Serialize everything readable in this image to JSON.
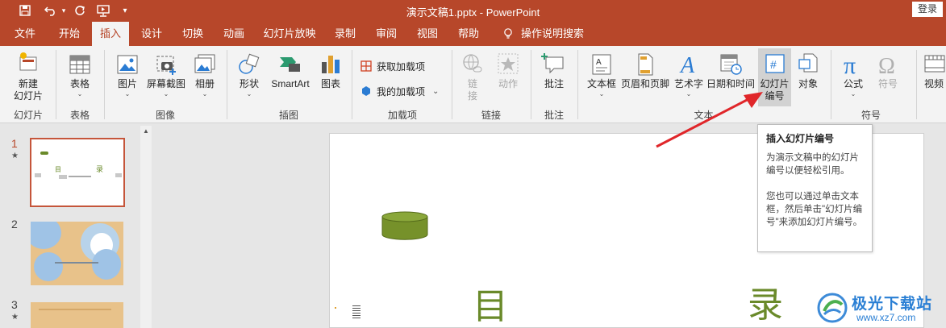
{
  "titlebar": {
    "doc_title": "演示文稿1.pptx  -  PowerPoint",
    "login": "登录",
    "bg_color": "#b7472a"
  },
  "qat": [
    {
      "name": "save-icon"
    },
    {
      "name": "undo-icon"
    },
    {
      "name": "redo-icon"
    },
    {
      "name": "present-icon"
    },
    {
      "name": "customize-qat-icon"
    }
  ],
  "tabs": [
    "文件",
    "开始",
    "插入",
    "设计",
    "切换",
    "动画",
    "幻灯片放映",
    "录制",
    "审阅",
    "视图",
    "帮助"
  ],
  "active_tab": "插入",
  "tell_me": "操作说明搜索",
  "ribbon": {
    "new_slide": "新建\n幻灯片",
    "new_slide_l1": "新建",
    "new_slide_l2": "幻灯片",
    "table": "表格",
    "picture": "图片",
    "screenshot": "屏幕截图",
    "album": "相册",
    "shapes": "形状",
    "smartart": "SmartArt",
    "chart": "图表",
    "get_addins": "获取加载项",
    "my_addins": "我的加载项",
    "link_l1": "链",
    "link_l2": "接",
    "action": "动作",
    "comment": "批注",
    "textbox": "文本框",
    "header_footer": "页眉和页脚",
    "wordart": "艺术字",
    "datetime": "日期和时间",
    "slide_number_l1": "幻灯片",
    "slide_number_l2": "编号",
    "object": "对象",
    "equation": "公式",
    "symbol": "符号",
    "video": "视频"
  },
  "groups": {
    "slides": "幻灯片",
    "tables": "表格",
    "images": "图像",
    "illustrations": "插图",
    "addins": "加载项",
    "links": "链接",
    "comments": "批注",
    "text": "文本",
    "symbols": "符号"
  },
  "tooltip": {
    "title": "插入幻灯片编号",
    "para1": "为演示文稿中的幻灯片编号以便轻松引用。",
    "para2": "您也可以通过单击文本框，然后单击\"幻灯片编号\"来添加幻灯片编号。"
  },
  "slides": [
    {
      "number": "1",
      "star": "★"
    },
    {
      "number": "2",
      "star": ""
    },
    {
      "number": "3",
      "star": "★"
    }
  ],
  "slide_content": {
    "char1": "目",
    "char2": "录"
  },
  "watermark": {
    "name": "极光下载站",
    "url": "www.xz7.com"
  }
}
